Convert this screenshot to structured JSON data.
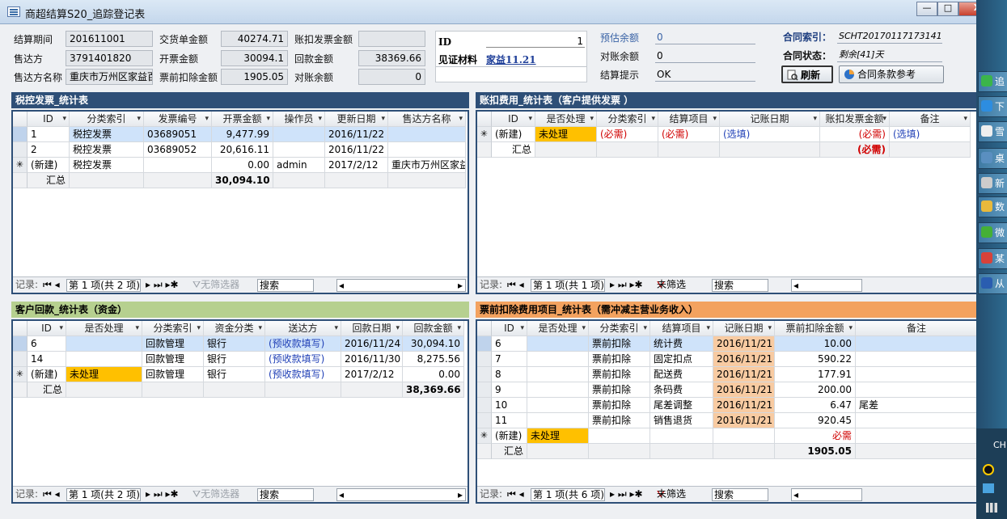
{
  "window": {
    "title": "商超结算S20_追踪登记表",
    "buttons": [
      "—",
      "□",
      "X"
    ]
  },
  "header": {
    "settle_period_label": "结算期间",
    "settle_period": "201611001",
    "seller_label": "售达方",
    "seller": "3791401820",
    "seller_name_label": "售达方名称",
    "seller_name": "重庆市万州区家益百",
    "delivery_amount_label": "交货单金额",
    "delivery_amount": "40274.71",
    "invoice_amount_label": "开票金额",
    "invoice_amount": "30094.1",
    "pre_deduct_label": "票前扣除金额",
    "pre_deduct": "1905.05",
    "deduct_invoice_label": "账扣发票金额",
    "deduct_invoice": "",
    "payment_label": "回款金额",
    "payment": "38369.66",
    "reconcile_label": "对账余额",
    "reconcile": "0",
    "id_label": "ID",
    "id_value": "1",
    "voucher_label": "见证材料",
    "voucher_value": "家益11.21",
    "est_balance_label": "预估余额",
    "est_balance": "0",
    "acct_balance_label": "对账余额",
    "acct_balance": "0",
    "settle_hint_label": "结算提示",
    "settle_hint": "OK",
    "contract_index_label": "合同索引：",
    "contract_index": "SCHT20170117173141",
    "contract_status_label": "合同状态：",
    "contract_status": "剩余[41]天",
    "refresh_button": "刷新",
    "contract_terms_button": "合同条款参考"
  },
  "tax_invoice": {
    "title": "税控发票_统计表",
    "columns": [
      "ID",
      "分类索引",
      "发票编号",
      "开票金额",
      "操作员",
      "更新日期",
      "售达方名称"
    ],
    "rows": [
      {
        "marker": "",
        "cells": [
          "1",
          "税控发票",
          "03689051",
          "9,477.99",
          "",
          "2016/11/22",
          ""
        ]
      },
      {
        "marker": "",
        "cells": [
          "2",
          "税控发票",
          "03689052",
          "20,616.11",
          "",
          "2016/11/22",
          ""
        ]
      },
      {
        "marker": "✳",
        "cells": [
          "(新建)",
          "税控发票",
          "",
          "0.00",
          "admin",
          "2017/2/12",
          "重庆市万州区家益"
        ]
      }
    ],
    "total_label": "汇总",
    "total": "30,094.10",
    "nav": {
      "record_label": "记录:",
      "position": "第 1 项(共 2 项)",
      "filter": "无筛选器",
      "search": "搜索"
    }
  },
  "account_deduct": {
    "title": "账扣费用_统计表（客户提供发票 ）",
    "columns": [
      "ID",
      "是否处理",
      "分类索引",
      "结算项目",
      "记账日期",
      "账扣发票金额",
      "备注"
    ],
    "new_row": {
      "marker": "✳",
      "id": "(新建)",
      "status": "未处理",
      "category": "(必需)",
      "item": "(必需)",
      "date": "(选填)",
      "amount": "(必需)",
      "note": "(选填)"
    },
    "total_label": "汇总",
    "total": "(必需)",
    "nav": {
      "record_label": "记录:",
      "position": "第 1 项(共 1 项)",
      "filter": "未筛选",
      "search": "搜索"
    }
  },
  "payment_table": {
    "title": "客户回款_统计表（资金）",
    "columns": [
      "ID",
      "是否处理",
      "分类索引",
      "资金分类",
      "送达方",
      "回款日期",
      "回款金额"
    ],
    "rows": [
      {
        "marker": "",
        "cells": [
          "6",
          "",
          "回款管理",
          "银行",
          "(预收款填写)",
          "2016/11/24",
          "30,094.10"
        ]
      },
      {
        "marker": "",
        "cells": [
          "14",
          "",
          "回款管理",
          "银行",
          "(预收款填写)",
          "2016/11/30",
          "8,275.56"
        ]
      },
      {
        "marker": "✳",
        "cells": [
          "(新建)",
          "未处理",
          "回款管理",
          "银行",
          "(预收款填写)",
          "2017/2/12",
          "0.00"
        ]
      }
    ],
    "total_label": "汇总",
    "total": "38,369.66",
    "nav": {
      "record_label": "记录:",
      "position": "第 1 项(共 2 项)",
      "filter": "无筛选器",
      "search": "搜索"
    }
  },
  "pre_deduct_table": {
    "title": "票前扣除费用项目_统计表（需冲减主营业务收入）",
    "columns": [
      "ID",
      "是否处理",
      "分类索引",
      "结算项目",
      "记账日期",
      "票前扣除金额",
      "备注"
    ],
    "rows": [
      {
        "marker": "",
        "cells": [
          "6",
          "",
          "票前扣除",
          "统计费",
          "2016/11/21",
          "10.00",
          ""
        ]
      },
      {
        "marker": "",
        "cells": [
          "7",
          "",
          "票前扣除",
          "固定扣点",
          "2016/11/21",
          "590.22",
          ""
        ]
      },
      {
        "marker": "",
        "cells": [
          "8",
          "",
          "票前扣除",
          "配送费",
          "2016/11/21",
          "177.91",
          ""
        ]
      },
      {
        "marker": "",
        "cells": [
          "9",
          "",
          "票前扣除",
          "条码费",
          "2016/11/21",
          "200.00",
          ""
        ]
      },
      {
        "marker": "",
        "cells": [
          "10",
          "",
          "票前扣除",
          "尾差调整",
          "2016/11/21",
          "6.47",
          "尾差"
        ]
      },
      {
        "marker": "",
        "cells": [
          "11",
          "",
          "票前扣除",
          "销售退货",
          "2016/11/21",
          "920.45",
          ""
        ]
      },
      {
        "marker": "✳",
        "cells": [
          "(新建)",
          "未处理",
          "",
          "",
          "",
          "必需",
          ""
        ]
      }
    ],
    "total_label": "汇总",
    "total": "1905.05",
    "nav": {
      "record_label": "记录:",
      "position": "第 1 项(共 6 项)",
      "filter": "未筛选",
      "search": "搜索"
    }
  },
  "taskbar": {
    "items": [
      "追",
      "下",
      "雪",
      "桌",
      "新",
      "数",
      "微",
      "某",
      "从"
    ],
    "tray_text": "CH"
  }
}
